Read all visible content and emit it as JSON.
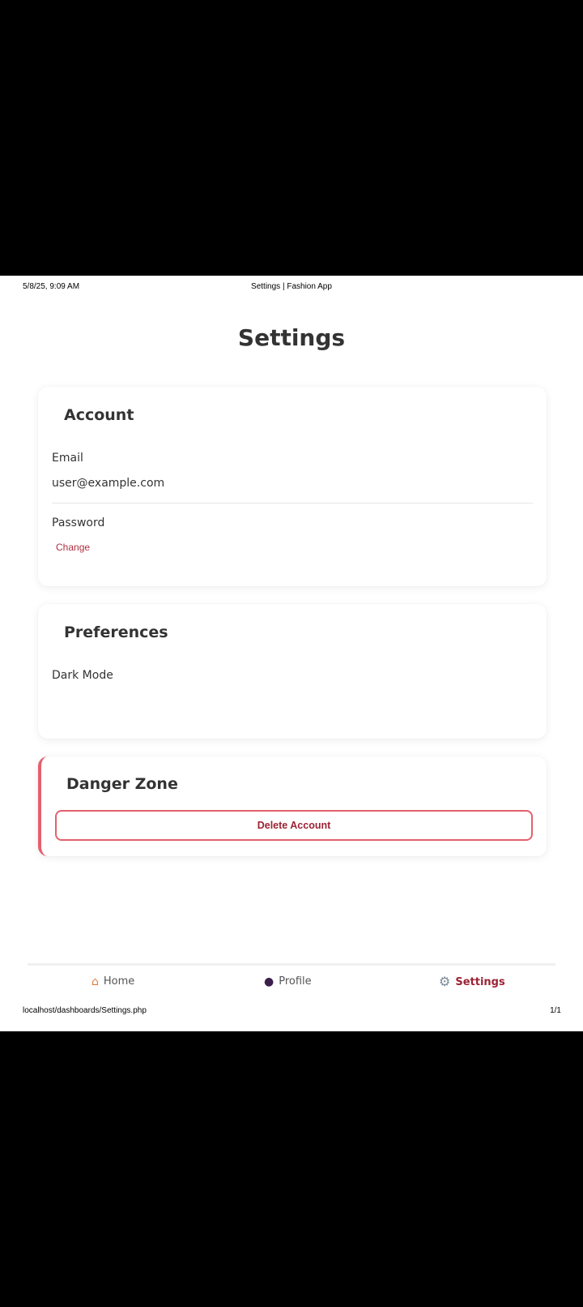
{
  "print_header": {
    "datetime": "5/8/25, 9:09 AM",
    "title": "Settings | Fashion App"
  },
  "page_title": "Settings",
  "account": {
    "title": "Account",
    "email_label": "Email",
    "email_value": "user@example.com",
    "password_label": "Password",
    "change_link": "Change"
  },
  "preferences": {
    "title": "Preferences",
    "dark_mode_label": "Dark Mode"
  },
  "danger_zone": {
    "title": "Danger Zone",
    "delete_button": "Delete Account"
  },
  "bottom_nav": {
    "items": [
      {
        "label": "Home",
        "icon": "home-icon",
        "active": false
      },
      {
        "label": "Profile",
        "icon": "profile-icon",
        "active": false
      },
      {
        "label": "Settings",
        "icon": "gear-icon",
        "active": true
      }
    ]
  },
  "print_footer": {
    "url": "localhost/dashboards/Settings.php",
    "page": "1/1"
  },
  "colors": {
    "accent": "#9b2335",
    "danger_border": "#e4606d"
  }
}
